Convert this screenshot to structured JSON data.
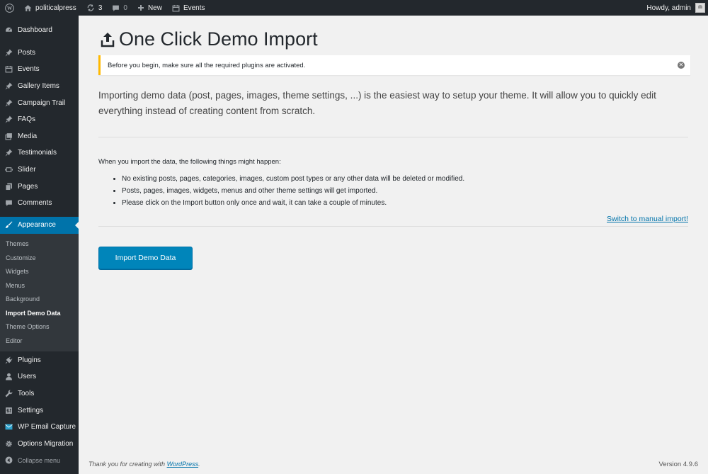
{
  "admin_bar": {
    "site_name": "politicalpress",
    "updates_count": "3",
    "comments_count": "0",
    "new_label": "New",
    "events_label": "Events",
    "greeting": "Howdy, admin"
  },
  "sidebar": {
    "items_top": [
      {
        "label": "Dashboard",
        "icon": "dashboard-icon"
      }
    ],
    "items_content": [
      {
        "label": "Posts",
        "icon": "pin-icon"
      },
      {
        "label": "Events",
        "icon": "calendar-icon"
      },
      {
        "label": "Gallery Items",
        "icon": "pin-icon"
      },
      {
        "label": "Campaign Trail",
        "icon": "pin-icon"
      },
      {
        "label": "FAQs",
        "icon": "pin-icon"
      },
      {
        "label": "Media",
        "icon": "media-icon"
      },
      {
        "label": "Testimonials",
        "icon": "pin-icon"
      },
      {
        "label": "Slider",
        "icon": "slider-icon"
      },
      {
        "label": "Pages",
        "icon": "pages-icon"
      },
      {
        "label": "Comments",
        "icon": "comment-icon"
      }
    ],
    "appearance": {
      "label": "Appearance",
      "icon": "brush-icon"
    },
    "submenu": [
      "Themes",
      "Customize",
      "Widgets",
      "Menus",
      "Background",
      "Import Demo Data",
      "Theme Options",
      "Editor"
    ],
    "submenu_active": "Import Demo Data",
    "items_bottom": [
      {
        "label": "Plugins",
        "icon": "plug-icon"
      },
      {
        "label": "Users",
        "icon": "user-icon"
      },
      {
        "label": "Tools",
        "icon": "wrench-icon"
      },
      {
        "label": "Settings",
        "icon": "settings-icon"
      },
      {
        "label": "WP Email Capture",
        "icon": "email-capture-icon"
      },
      {
        "label": "Options Migration",
        "icon": "gear-icon"
      }
    ],
    "collapse_label": "Collapse menu"
  },
  "main": {
    "title": "One Click Demo Import",
    "notice": "Before you begin, make sure all the required plugins are activated.",
    "intro": "Importing demo data (post, pages, images, theme settings, ...) is the easiest way to setup your theme. It will allow you to quickly edit everything instead of creating content from scratch.",
    "happen_heading": "When you import the data, the following things might happen:",
    "happen_list": [
      "No existing posts, pages, categories, images, custom post types or any other data will be deleted or modified.",
      "Posts, pages, images, widgets, menus and other theme settings will get imported.",
      "Please click on the Import button only once and wait, it can take a couple of minutes."
    ],
    "manual_link": "Switch to manual import!",
    "import_button": "Import Demo Data"
  },
  "footer": {
    "thanks_prefix": "Thank you for creating with ",
    "wordpress_link": "WordPress",
    "thanks_suffix": ".",
    "version": "Version 4.9.6"
  },
  "colors": {
    "admin_bar_bg": "#23282d",
    "accent": "#0073aa",
    "button": "#0085ba",
    "notice_border": "#ffb900"
  }
}
